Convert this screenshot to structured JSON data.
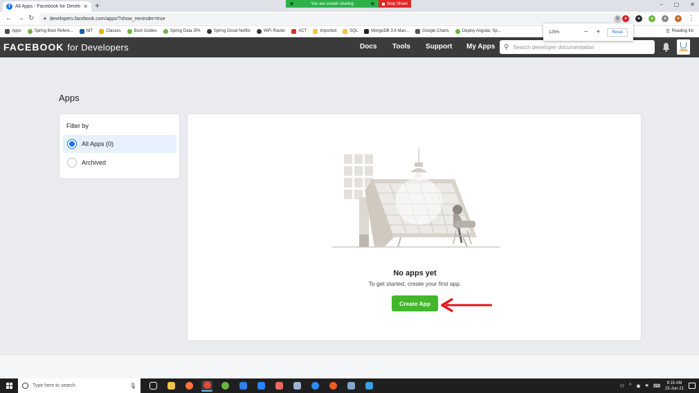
{
  "browser": {
    "tab_title": "All Apps - Facebook for Developers",
    "tab_favicon": "f",
    "new_tab": "+",
    "url": "developers.facebook.com/apps/?show_reminder=true",
    "zoom_percent": "125%",
    "zoom_minus": "−",
    "zoom_plus": "+",
    "zoom_reset": "Reset",
    "screen_share_text": "You are screen sharing",
    "stop_share": "Stop Share",
    "window_controls": [
      "−",
      "▢",
      "✕"
    ],
    "reading_list": "Reading list",
    "bookmarks": [
      {
        "label": "Apps",
        "color": "#4a4a4a"
      },
      {
        "label": "Spring Boot Refere...",
        "color": "#6db33f"
      },
      {
        "label": "NIT",
        "color": "#1a5fb4"
      },
      {
        "label": "Classes",
        "color": "#e8b400"
      },
      {
        "label": "Boot Guides",
        "color": "#6db33f"
      },
      {
        "label": "Spring Data JPA",
        "color": "#6db33f"
      },
      {
        "label": "Spring Cloud Netflix",
        "color": "#333333"
      },
      {
        "label": "WiFi Router",
        "color": "#333333"
      },
      {
        "label": "ACT",
        "color": "#d32f2f"
      },
      {
        "label": "Imported",
        "color": "#f4c542"
      },
      {
        "label": "SQL",
        "color": "#f4c542"
      },
      {
        "label": "MongoDB 3.6 Man...",
        "color": "#222222"
      },
      {
        "label": "Google Charts",
        "color": "#555555"
      },
      {
        "label": "Deploy Angular, Sp...",
        "color": "#6db33f"
      }
    ]
  },
  "header": {
    "brand_main": "FACEBOOK",
    "brand_sub": "for Developers",
    "nav": [
      "Docs",
      "Tools",
      "Support",
      "My Apps"
    ],
    "search_placeholder": "Search developer documentation",
    "java_label": "Java"
  },
  "page": {
    "title": "Apps",
    "filter": {
      "title": "Filter by",
      "options": [
        {
          "label": "All Apps (0)",
          "selected": true
        },
        {
          "label": "Archived",
          "selected": false
        }
      ]
    },
    "empty": {
      "title": "No apps yet",
      "subtitle": "To get started, create your first app.",
      "button": "Create App"
    }
  },
  "taskbar": {
    "search_placeholder": "Type here to search",
    "time": "9:15 AM",
    "date": "23-Jun-21",
    "colors": {
      "accent": "#42b72a",
      "selected": "#1877f2",
      "arrow": "#e8141b"
    }
  }
}
